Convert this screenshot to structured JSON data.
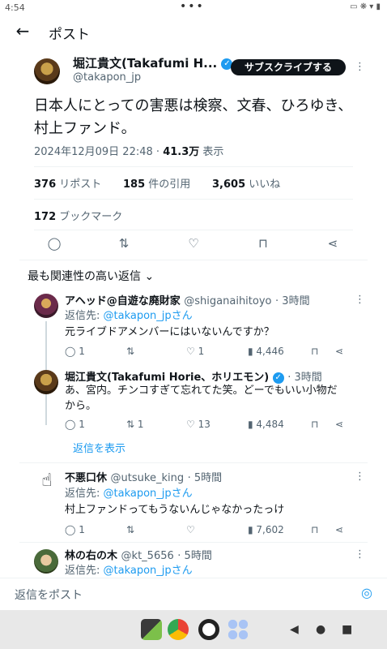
{
  "status_bar": {
    "time": "4:54",
    "dots": "•••",
    "icons": "▭ ❋ ▾ ▮"
  },
  "header": {
    "back_icon": "←",
    "title": "ポスト"
  },
  "post": {
    "author_name": "堀江貴文(Takafumi H...",
    "verified_glyph": "✓",
    "handle": "@takapon_jp",
    "subscribe_label": "サブスクライブする",
    "more_glyph": "⋮",
    "text": "日本人にとっての害悪は検察、文春、ひろゆき、村上ファンド。",
    "date": "2024年12月09日 22:48",
    "separator": "·",
    "views_count": "41.3万",
    "views_label": "表示",
    "reposts_count": "376",
    "reposts_label": "リポスト",
    "quotes_count": "185",
    "quotes_label": "件の引用",
    "likes_count": "3,605",
    "likes_label": "いいね",
    "bookmarks_count": "172",
    "bookmarks_label": "ブックマーク",
    "actions": {
      "reply_icon": "◯",
      "repost_icon": "⇅",
      "like_icon": "♡",
      "bookmark_icon": "⊓",
      "share_icon": "⋖"
    }
  },
  "sort": {
    "label": "最も関連性の高い返信",
    "chevron": "⌄"
  },
  "replies": [
    {
      "name": "アヘッド@自遊な廃財家",
      "handle": "@shiganaihitoyo",
      "time": "· 3時間",
      "reply_to_prefix": "返信先: ",
      "reply_to": "@takapon_jpさん",
      "text": "元ライブドアメンバーにはいないんですか？",
      "replies": "1",
      "reposts": "",
      "likes": "1",
      "views": "4,446"
    },
    {
      "name": "堀江貴文(Takafumi Horie、ホリエモン)",
      "handle": "",
      "time": "· 3時間",
      "text": "あ、宮内。チンコすぎて忘れてた笑。どーでもいい小物だから。",
      "replies": "1",
      "reposts": "1",
      "likes": "13",
      "views": "4,484"
    },
    {
      "name": "不悪口休",
      "handle": "@utsuke_king",
      "time": "· 5時間",
      "reply_to_prefix": "返信先: ",
      "reply_to": "@takapon_jpさん",
      "text": "村上ファンドってもうないんじゃなかったっけ",
      "replies": "1",
      "reposts": "",
      "likes": "",
      "views": "7,602"
    },
    {
      "name": "林の右の木",
      "handle": "@kt_5656",
      "time": "· 5時間",
      "reply_to_prefix": "返信先: ",
      "reply_to": "@takapon_jpさん"
    }
  ],
  "show_replies": "返信を表示",
  "composer": {
    "placeholder": "返信をポスト",
    "camera_icon": "◎"
  },
  "nav": {
    "back": "◀",
    "home": "●",
    "recent": "■"
  },
  "colors": {
    "accent": "#1d9bf0",
    "text": "#0f1419",
    "muted": "#536471"
  }
}
